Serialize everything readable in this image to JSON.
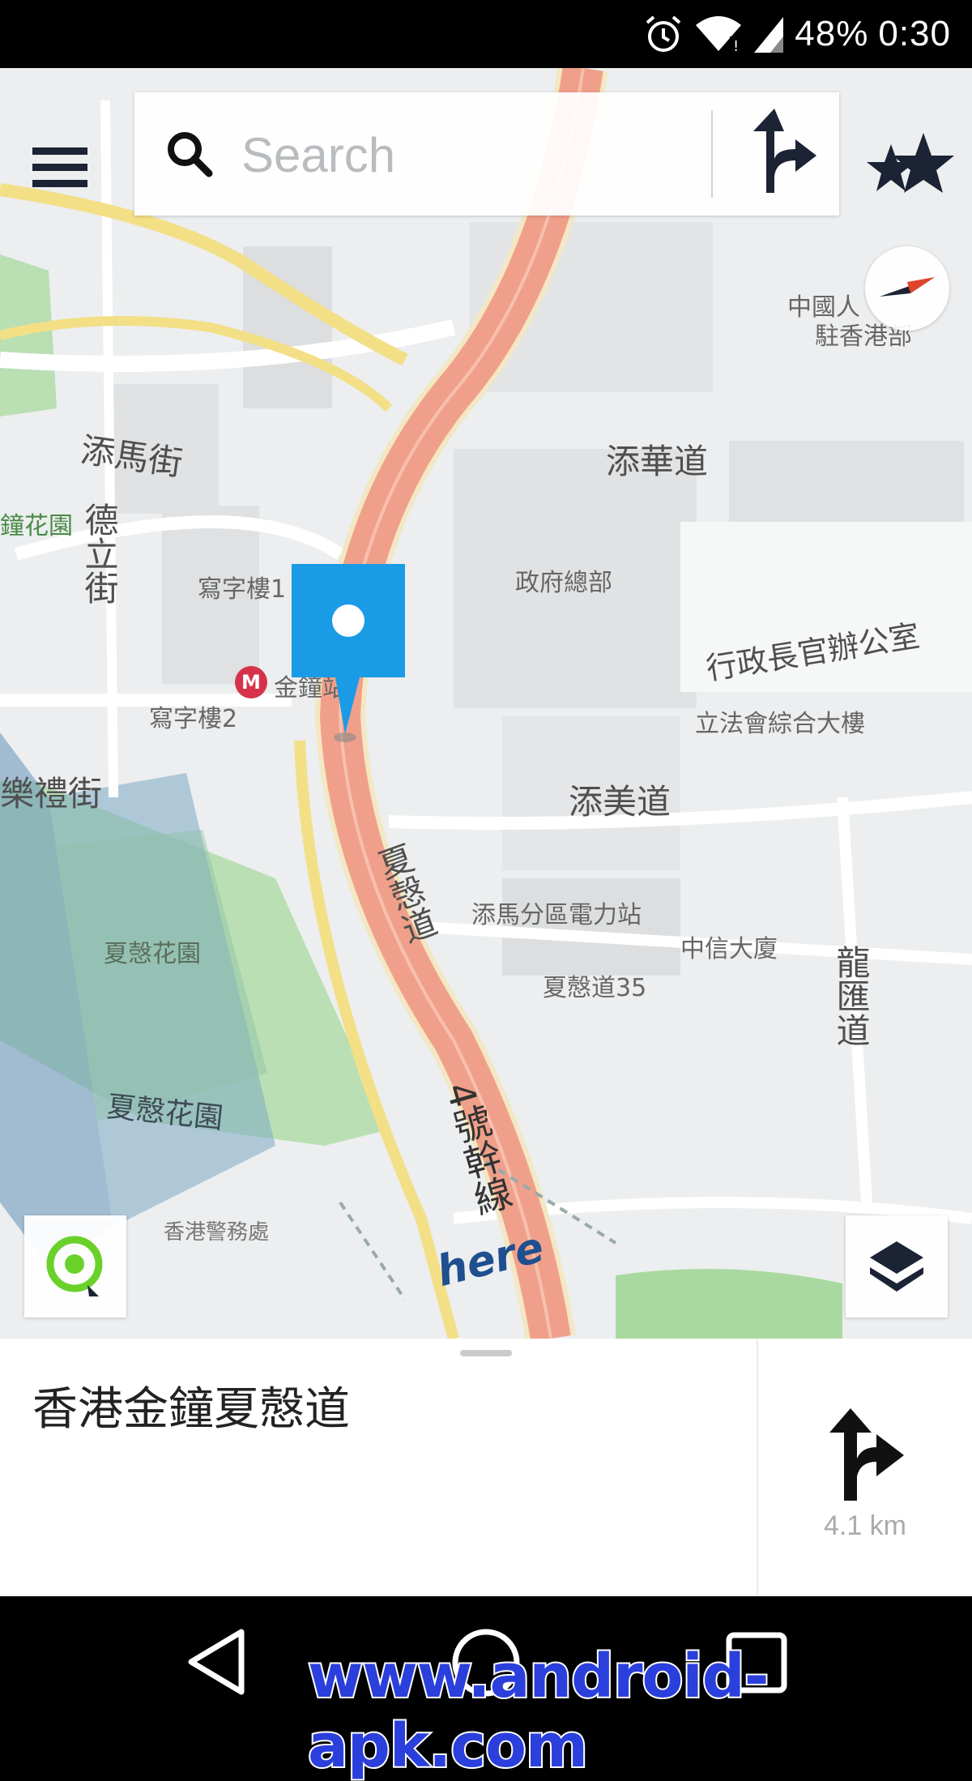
{
  "status_bar": {
    "battery": "48%",
    "time": "0:30",
    "icons": [
      "alarm-icon",
      "wifi-icon",
      "signal-icon"
    ]
  },
  "search": {
    "placeholder": "Search",
    "menu_icon": "menu-icon",
    "route_icon": "directions-icon",
    "favorites_icon": "favorites-stars-icon"
  },
  "map": {
    "labels": {
      "tim_ma_street": "添馬街",
      "tim_wa_avenue": "添華道",
      "tak_lap_street": "德立街",
      "government_hq": "政府總部",
      "chief_exec_office": "行政長官辦公室",
      "legco_complex": "立法會綜合大樓",
      "tim_mei_avenue": "添美道",
      "harcourt_road": "夏愨道",
      "tim_ma_substation": "添馬分區電力站",
      "citic_tower": "中信大廈",
      "harcourt_road_35": "夏慤道35",
      "lung_wui_road": "龍匯道",
      "harcourt_garden_1": "夏愨花園",
      "harcourt_garden_2": "夏慤花園",
      "route4": "4號幹線",
      "office1": "寫字樓1",
      "office2": "寫字樓2",
      "admiralty_station": "金鐘站",
      "garden_road_edge": "鐘花園",
      "hkrc_road": "樂禮街",
      "pla_building": "中國人",
      "pla_building_2": "駐香港部",
      "hk_pacific_place": "香港警務處"
    },
    "logo": "here"
  },
  "place": {
    "name": "香港金鐘夏慤道",
    "distance": "4.1 km"
  },
  "nav_bar": {
    "watermark": "www.android-apk.com"
  },
  "colors": {
    "pin": "#1a9be6",
    "road_major": "#f0a08a",
    "road_yellow": "#f3df86",
    "park": "#a9d9a0",
    "locate": "#6ad12a"
  }
}
